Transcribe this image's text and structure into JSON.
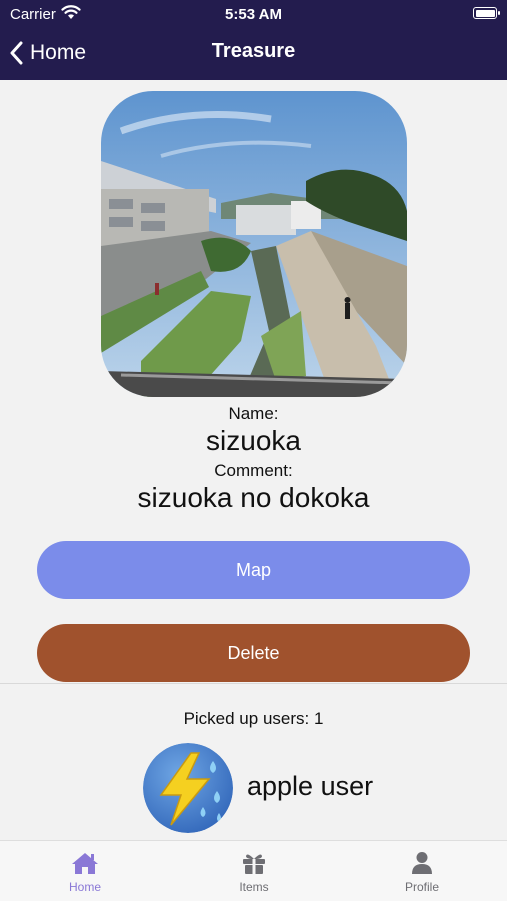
{
  "status_bar": {
    "carrier": "Carrier",
    "time": "5:53 AM"
  },
  "nav": {
    "back_label": "Home",
    "title": "Treasure"
  },
  "treasure": {
    "name_label": "Name:",
    "name": "sizuoka",
    "comment_label": "Comment:",
    "comment": "sizuoka no dokoka"
  },
  "buttons": {
    "map": "Map",
    "delete": "Delete"
  },
  "picked": {
    "label": "Picked up users: 1",
    "users": [
      {
        "name": "apple user"
      }
    ]
  },
  "tabs": [
    {
      "label": "Home",
      "icon": "home-icon",
      "active": true
    },
    {
      "label": "Items",
      "icon": "gift-icon",
      "active": false
    },
    {
      "label": "Profile",
      "icon": "person-icon",
      "active": false
    }
  ],
  "colors": {
    "header_bg": "#231c4e",
    "map_button": "#7b8cea",
    "delete_button": "#a0522d",
    "tab_active": "#8a78d6",
    "tab_inactive": "#6e6e73"
  }
}
